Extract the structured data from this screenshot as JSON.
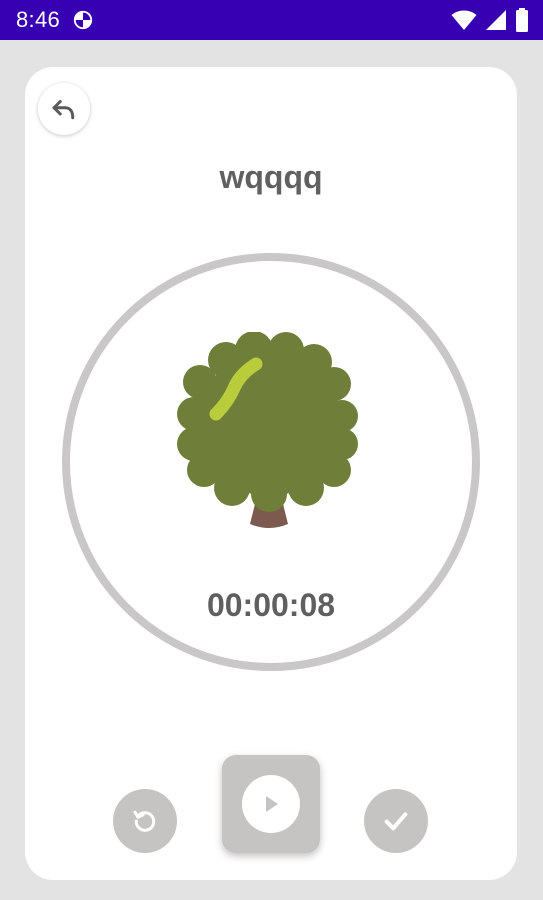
{
  "status_bar": {
    "time": "8:46",
    "app_icon": "circle-pie-icon",
    "wifi_icon": "wifi-icon",
    "signal_icon": "signal-icon",
    "battery_icon": "battery-icon"
  },
  "card": {
    "back_icon": "undo-arrow-icon",
    "title": "wqqqq",
    "timer": "00:00:08",
    "tree_icon": "tree-icon"
  },
  "controls": {
    "reset_icon": "reset-icon",
    "play_icon": "play-icon",
    "done_icon": "checkmark-icon"
  },
  "colors": {
    "status_bar": "#3700b3",
    "ring": "#c9c7c7",
    "control_bg": "#c6c3c3",
    "tree_canopy": "#6f7f3a",
    "tree_highlight": "#b9cc3b",
    "tree_trunk": "#7d5a4f"
  }
}
